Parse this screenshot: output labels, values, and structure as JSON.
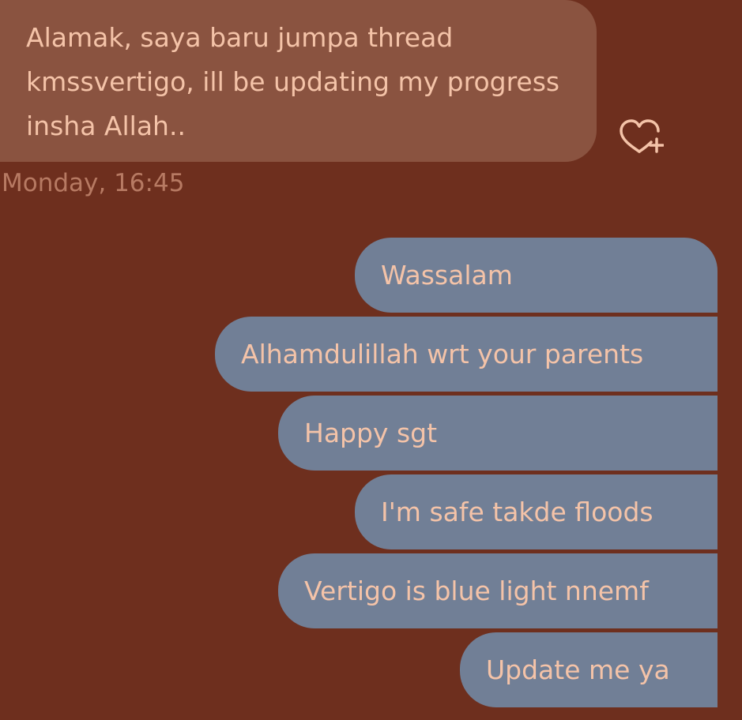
{
  "conversation": {
    "incoming": {
      "text": "Alamak, saya baru jumpa thread kmssvertigo, ill be updating my progress insha Allah..",
      "timestamp": "Monday, 16:45",
      "reaction_icon": "heart-plus-icon"
    },
    "outgoing": [
      {
        "text": "Wassalam"
      },
      {
        "text": "Alhamdulillah wrt your parents"
      },
      {
        "text": "Happy sgt"
      },
      {
        "text": "I'm safe takde floods"
      },
      {
        "text": "Vertigo is blue light nnemf"
      },
      {
        "text": "Update me ya"
      }
    ]
  },
  "colors": {
    "background": "#6e2f1e",
    "incoming_bubble": "#8a5340",
    "outgoing_bubble": "#717f96",
    "message_text": "#f4c3a8",
    "timestamp_text": "#b77a63"
  }
}
